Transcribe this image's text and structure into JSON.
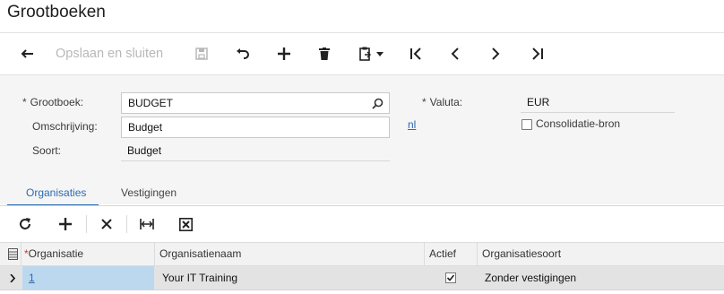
{
  "page": {
    "title": "Grootboeken"
  },
  "toolbar": {
    "save_close_label": "Opslaan en sluiten",
    "icons": [
      "back-icon",
      "save-icon",
      "undo-icon",
      "add-icon",
      "delete-icon",
      "clipboard-icon",
      "first-icon",
      "prev-icon",
      "next-icon",
      "last-icon"
    ]
  },
  "form": {
    "ledger_label": "Grootboek:",
    "ledger_value": "BUDGET",
    "description_label": "Omschrijving:",
    "description_value": "Budget",
    "type_label": "Soort:",
    "type_value": "Budget",
    "currency_label": "Valuta:",
    "currency_value": "EUR",
    "lang_link": "nl",
    "consolidation_label": "Consolidatie-bron",
    "consolidation_checked": false,
    "required_mark": "*"
  },
  "tabs": [
    {
      "label": "Organisaties",
      "active": true
    },
    {
      "label": "Vestigingen",
      "active": false
    }
  ],
  "grid": {
    "columns": [
      "Organisatie",
      "Organisatienaam",
      "Actief",
      "Organisatiesoort"
    ],
    "rows": [
      {
        "organisatie": "1",
        "organisatienaam": "Your IT Training",
        "actief": true,
        "organisatiesoort": "Zonder vestigingen"
      }
    ]
  },
  "colors": {
    "accent": "#2a6bb3",
    "form_bg": "#f5f5f5",
    "selected_cell": "#bcd8ef"
  }
}
